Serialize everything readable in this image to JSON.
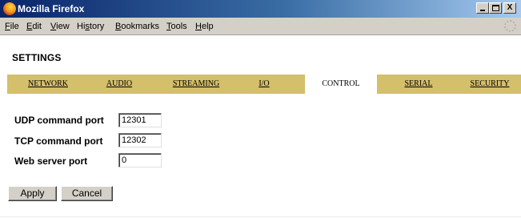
{
  "window": {
    "title": "Mozilla Firefox",
    "controls": {
      "minimize": "_",
      "maximize": "□",
      "close": "X"
    }
  },
  "menubar": [
    {
      "id": "file",
      "label": "File",
      "mnemonic": "F",
      "rest": "ile"
    },
    {
      "id": "edit",
      "label": "Edit",
      "mnemonic": "E",
      "rest": "dit"
    },
    {
      "id": "view",
      "label": "View",
      "mnemonic": "V",
      "rest": "iew"
    },
    {
      "id": "history",
      "label": "History",
      "pre": "Hi",
      "mnemonic": "s",
      "rest": "tory"
    },
    {
      "id": "bookmarks",
      "label": "Bookmarks",
      "mnemonic": "B",
      "rest": "ookmarks"
    },
    {
      "id": "tools",
      "label": "Tools",
      "mnemonic": "T",
      "rest": "ools"
    },
    {
      "id": "help",
      "label": "Help",
      "mnemonic": "H",
      "rest": "elp"
    }
  ],
  "page": {
    "title": "SETTINGS"
  },
  "tabs": [
    {
      "label": "NETWORK",
      "active": false
    },
    {
      "label": "AUDIO",
      "active": false
    },
    {
      "label": "STREAMING",
      "active": false
    },
    {
      "label": "I/O",
      "active": false
    },
    {
      "label": "CONTROL",
      "active": true
    },
    {
      "label": "SERIAL",
      "active": false
    },
    {
      "label": "SECURITY",
      "active": false
    }
  ],
  "form": {
    "udp_label": "UDP command port",
    "udp_value": "12301",
    "tcp_label": "TCP command port",
    "tcp_value": "12302",
    "web_label": "Web server port",
    "web_value": "0"
  },
  "buttons": {
    "apply": "Apply",
    "cancel": "Cancel"
  },
  "colors": {
    "tab_bar": "#d4bf6a",
    "title_bar_start": "#0a246a",
    "title_bar_end": "#a6caf0",
    "chrome": "#d4d0c8"
  }
}
